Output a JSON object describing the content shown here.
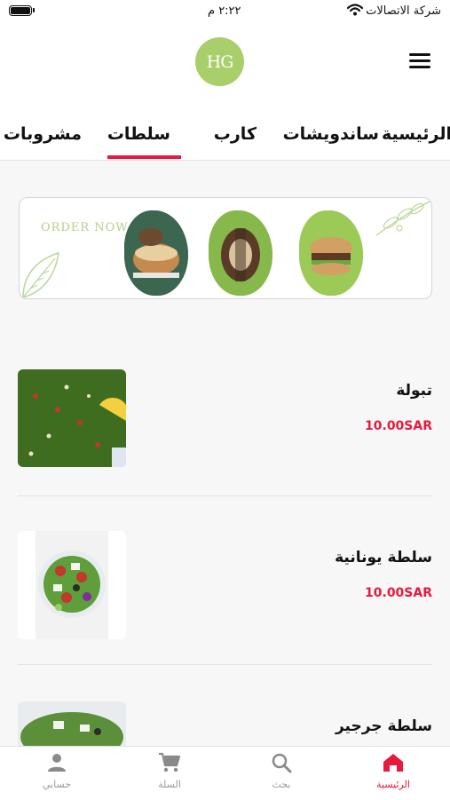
{
  "status_bar": {
    "carrier": "شركة الاتصالات",
    "time": "٢:٢٢ م"
  },
  "header": {
    "logo_text": "HG",
    "menu_icon": "hamburger-menu-icon"
  },
  "tabs": {
    "items": [
      {
        "label": "الرئيسية"
      },
      {
        "label": "ساندويشات"
      },
      {
        "label": "كارب"
      },
      {
        "label": "سلطات"
      },
      {
        "label": "مشروبات"
      }
    ],
    "active_index": 3
  },
  "banner": {
    "text": "ORDER NOW"
  },
  "products": [
    {
      "name": "تبولة",
      "price": "10.00SAR"
    },
    {
      "name": "سلطة يونانية",
      "price": "10.00SAR"
    },
    {
      "name": "سلطة جرجير"
    }
  ],
  "bottom_nav": {
    "items": [
      {
        "label": "الرئيسية",
        "icon": "home-icon"
      },
      {
        "label": "بحث",
        "icon": "search-icon"
      },
      {
        "label": "السلة",
        "icon": "cart-icon"
      },
      {
        "label": "حسابي",
        "icon": "person-icon"
      }
    ],
    "active_index": 0
  },
  "colors": {
    "accent": "#e8193c",
    "logo": "#a9cf6a",
    "banner_text": "#b3cf8a"
  }
}
